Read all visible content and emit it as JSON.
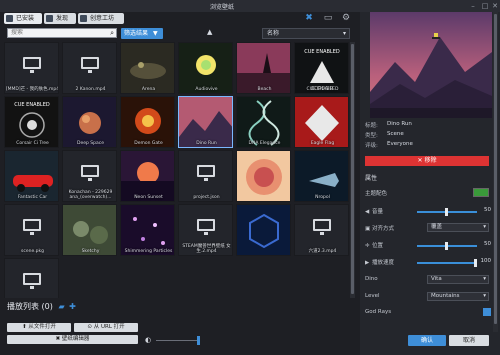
{
  "window": {
    "title": "浏览壁纸"
  },
  "tabs": [
    {
      "label": "已安装",
      "icon": "folder-icon"
    },
    {
      "label": "发现",
      "icon": "compass-icon"
    },
    {
      "label": "创意工坊",
      "icon": "workshop-icon"
    }
  ],
  "toolbar": {
    "search_placeholder": "搜索",
    "filter_label": "筛选结果",
    "sort_label": "名称"
  },
  "wallpapers": [
    {
      "name": "[MMD]芒 - 我的肤色.mp4",
      "thumb": "monitor"
    },
    {
      "name": "2 Kanon.mp4",
      "thumb": "monitor"
    },
    {
      "name": "Arena",
      "thumb": "arena"
    },
    {
      "name": "Audiovive",
      "thumb": "audio"
    },
    {
      "name": "Beach",
      "thumb": "beach"
    },
    {
      "name": "CUE ENABLED",
      "thumb": "corsair"
    },
    {
      "name": "Corsair Ci Tree",
      "thumb": "cue"
    },
    {
      "name": "Deep Space",
      "thumb": "space"
    },
    {
      "name": "Demon Gate",
      "thumb": "demon"
    },
    {
      "name": "Dino Run",
      "thumb": "dino"
    },
    {
      "name": "DNA Elegance",
      "thumb": "dna"
    },
    {
      "name": "Eagle Flag",
      "thumb": "eagle"
    },
    {
      "name": "Fantastic Car",
      "thumb": "car"
    },
    {
      "name": "Konachan - 229629 ana_(overwatch)...",
      "thumb": "monitor"
    },
    {
      "name": "Neon Sunset",
      "thumb": "neon"
    },
    {
      "name": "project.json",
      "thumb": "monitor"
    },
    {
      "name": "",
      "thumb": "circles"
    },
    {
      "name": "Nropol",
      "thumb": "shark"
    },
    {
      "name": "scene.pkg",
      "thumb": "monitor"
    },
    {
      "name": "Sketchy",
      "thumb": "sketchy"
    },
    {
      "name": "Shimmering Particles",
      "thumb": "particles"
    },
    {
      "name": "STEAM魔兽世界壁纸 女生.2.mp4",
      "thumb": "monitor"
    },
    {
      "name": "",
      "thumb": "hex"
    },
    {
      "name": "六道2.3.mp4",
      "thumb": "monitor"
    },
    {
      "name": "",
      "thumb": "monitor"
    }
  ],
  "playlist": {
    "title": "播放列表",
    "count": "(0)",
    "open_file": "从文件打开",
    "open_url": "从 URL 打开",
    "editor": "壁纸编辑器"
  },
  "details": {
    "title_key": "标题:",
    "title_val": "Dino Run",
    "type_key": "类型:",
    "type_val": "Scene",
    "rating_key": "评级:",
    "rating_val": "Everyone",
    "remove_label": "移除"
  },
  "properties": {
    "header": "属性",
    "scheme_color_label": "主题配色",
    "volume_label": "音量",
    "volume_val": "50",
    "align_label": "对齐方式",
    "align_val": "覆盖",
    "position_label": "位置",
    "position_val": "50",
    "speed_label": "播放速度",
    "speed_val": "100",
    "dino_label": "Dino",
    "dino_val": "Vita",
    "level_label": "Level",
    "level_val": "Mountains",
    "godrays_label": "God Rays"
  },
  "actions": {
    "ok": "确认",
    "cancel": "取消"
  },
  "colors": {
    "accent": "#3e8ed8",
    "danger": "#dd3333",
    "scheme": "#3a9a3a"
  }
}
